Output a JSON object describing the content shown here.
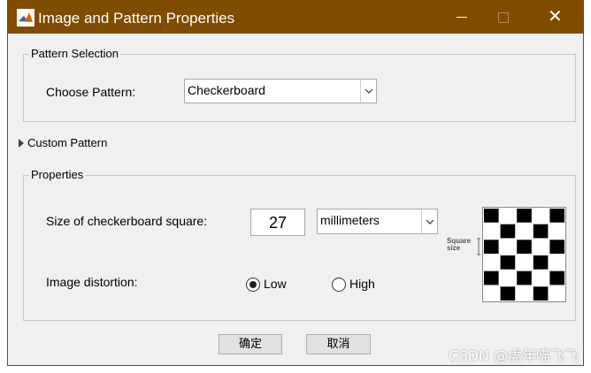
{
  "window": {
    "title": "Image and Pattern Properties"
  },
  "pattern_selection": {
    "legend": "Pattern Selection",
    "choose_label": "Choose Pattern:",
    "selected": "Checkerboard"
  },
  "custom_pattern": {
    "label": "Custom Pattern"
  },
  "properties": {
    "legend": "Properties",
    "size_label": "Size of checkerboard square:",
    "size_value": "27",
    "unit": "millimeters",
    "distortion_label": "Image distortion:",
    "distortion_options": [
      "Low",
      "High"
    ],
    "distortion_selected": "Low",
    "preview_label_line1": "Square",
    "preview_label_line2": "size"
  },
  "buttons": {
    "ok": "确定",
    "cancel": "取消"
  },
  "watermark": "CSDN @虎年喵飞飞"
}
